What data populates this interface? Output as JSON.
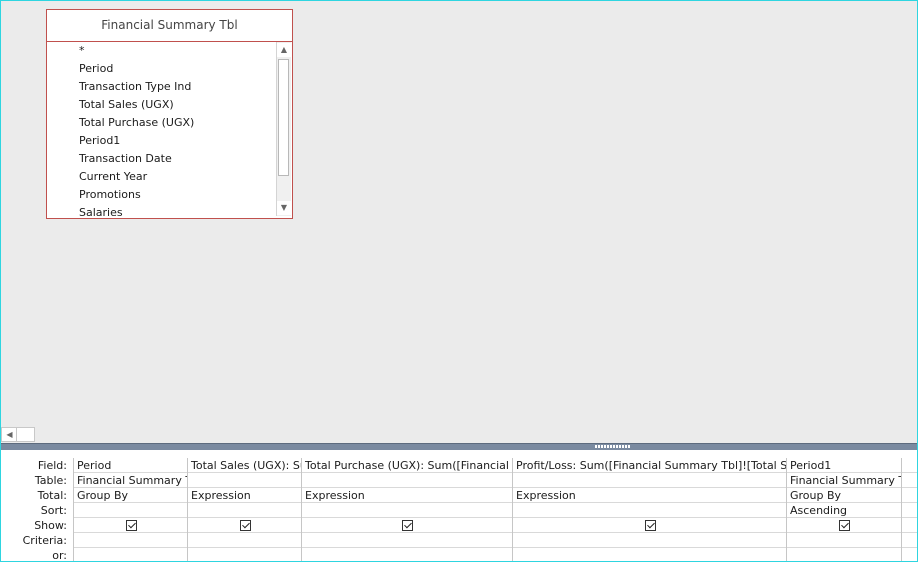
{
  "table": {
    "title": "Financial Summary Tbl",
    "fields": [
      "*",
      "Period",
      "Transaction Type Ind",
      "Total Sales (UGX)",
      "Total Purchase (UGX)",
      "Period1",
      "Transaction Date",
      "Current Year",
      "Promotions",
      "Salaries"
    ]
  },
  "grid": {
    "row_labels": [
      "Field:",
      "Table:",
      "Total:",
      "Sort:",
      "Show:",
      "Criteria:",
      "or:"
    ],
    "columns": [
      {
        "field": "Period",
        "table": "Financial Summary Tb",
        "total": "Group By",
        "sort": "",
        "show": true
      },
      {
        "field": "Total Sales (UGX): Sum",
        "table": "",
        "total": "Expression",
        "sort": "",
        "show": true
      },
      {
        "field": "Total Purchase (UGX): Sum([Financial Sur",
        "table": "",
        "total": "Expression",
        "sort": "",
        "show": true
      },
      {
        "field": "Profit/Loss: Sum([Financial Summary Tbl]![Total Sales",
        "table": "",
        "total": "Expression",
        "sort": "",
        "show": true
      },
      {
        "field": "Period1",
        "table": "Financial Summary Tb",
        "total": "Group By",
        "sort": "Ascending",
        "show": true
      },
      {
        "field": "",
        "table": "",
        "total": "",
        "sort": "",
        "show": false
      }
    ]
  },
  "icons": {
    "scroll_up": "scroll-up-arrow",
    "scroll_down": "scroll-down-arrow",
    "scroll_left": "scroll-left-arrow",
    "checkbox": "checkbox-checked"
  }
}
